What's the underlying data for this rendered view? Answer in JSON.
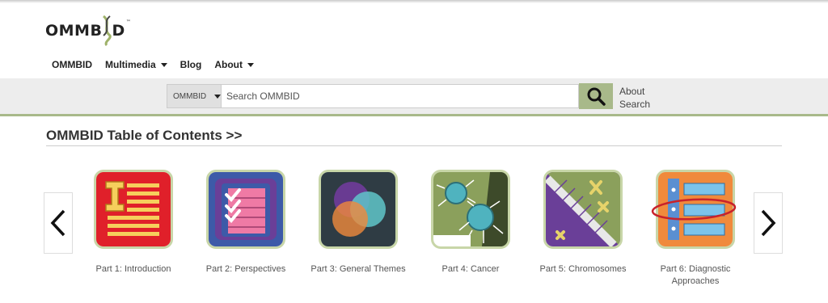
{
  "brand": {
    "logo_text_left": "OMMB",
    "logo_text_right": "D",
    "logo_tm": "™"
  },
  "nav": {
    "items": [
      "OMMBID",
      "Multimedia",
      "Blog",
      "About"
    ]
  },
  "search": {
    "scope": "OMMBID",
    "placeholder": "Search OMMBID",
    "about_line1": "About",
    "about_line2": "Search"
  },
  "toc": {
    "title": "OMMBID Table of Contents >>"
  },
  "parts": [
    {
      "label": "Part 1: Introduction",
      "icon": "introduction-icon"
    },
    {
      "label": "Part 2: Perspectives",
      "icon": "checklist-icon"
    },
    {
      "label": "Part 3: General Themes",
      "icon": "venn-diagram-icon"
    },
    {
      "label": "Part 4: Cancer",
      "icon": "cancer-cell-icon"
    },
    {
      "label": "Part 5: Chromosomes",
      "icon": "chromosome-icon"
    },
    {
      "label": "Part 6: Diagnostic Approaches",
      "icon": "diagnostic-panel-icon"
    }
  ],
  "colors": {
    "accent": "#a8b98a",
    "search_bar_bg": "#ededed",
    "tile_border": "#c8d6a8"
  }
}
